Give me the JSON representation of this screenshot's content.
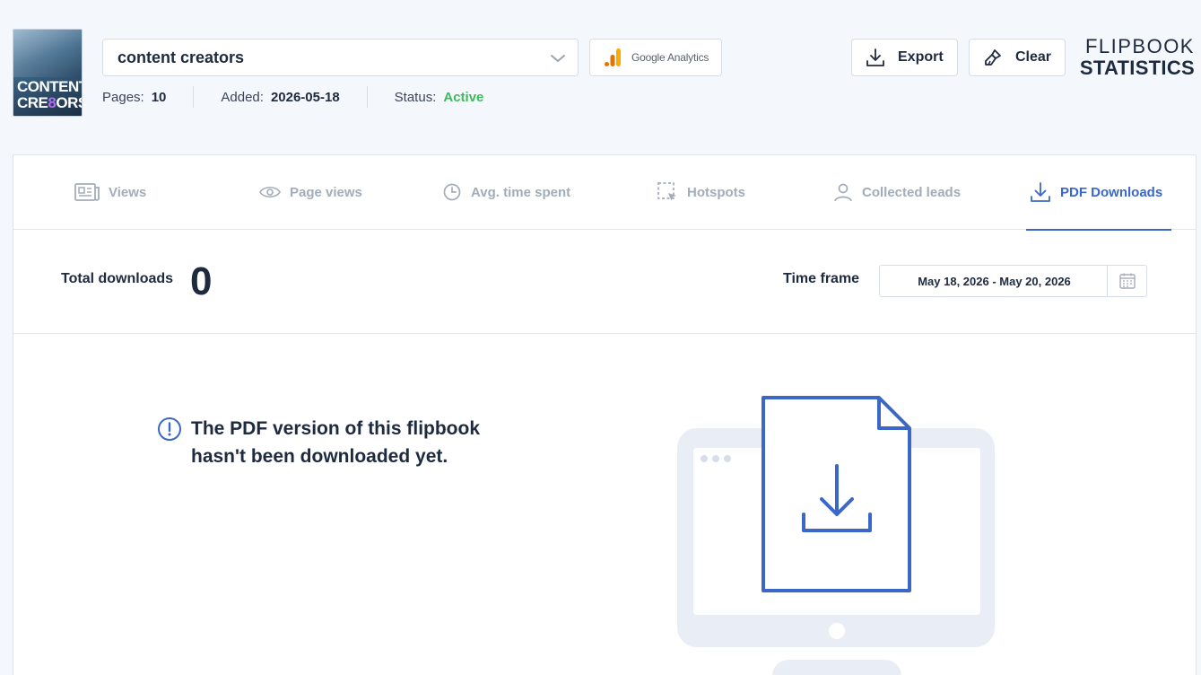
{
  "header": {
    "cover": {
      "line1": "CONTENT",
      "line2_a": "CRE",
      "line2_accent": "8",
      "line2_b": "ORS"
    },
    "selected_flipbook": "content creators",
    "google_analytics_label": "Google Analytics",
    "meta": {
      "pages_label": "Pages:",
      "pages_value": "10",
      "added_label": "Added:",
      "added_value": "2026-05-18",
      "status_label": "Status:",
      "status_value": "Active"
    },
    "export_label": "Export",
    "clear_label": "Clear",
    "brand_line1": "FLIPBOOK",
    "brand_line2": "STATISTICS"
  },
  "tabs": [
    {
      "label": "Views",
      "icon": "newspaper-icon",
      "active": false
    },
    {
      "label": "Page views",
      "icon": "eye-icon",
      "active": false
    },
    {
      "label": "Avg. time spent",
      "icon": "clock-icon",
      "active": false
    },
    {
      "label": "Hotspots",
      "icon": "hotspot-icon",
      "active": false
    },
    {
      "label": "Collected leads",
      "icon": "user-icon",
      "active": false
    },
    {
      "label": "PDF Downloads",
      "icon": "download-icon",
      "active": true
    }
  ],
  "summary": {
    "total_label": "Total downloads",
    "total_value": "0",
    "timeframe_label": "Time frame",
    "date_range": "May 18, 2026 - May 20, 2026"
  },
  "empty_state": {
    "message": "The PDF version of this flipbook hasn't been downloaded yet."
  },
  "colors": {
    "accent": "#3a67c8",
    "active_status": "#3fb95c",
    "text": "#1e2a3f",
    "muted_tab": "#a3acb9",
    "background": "#f4f7fc"
  }
}
